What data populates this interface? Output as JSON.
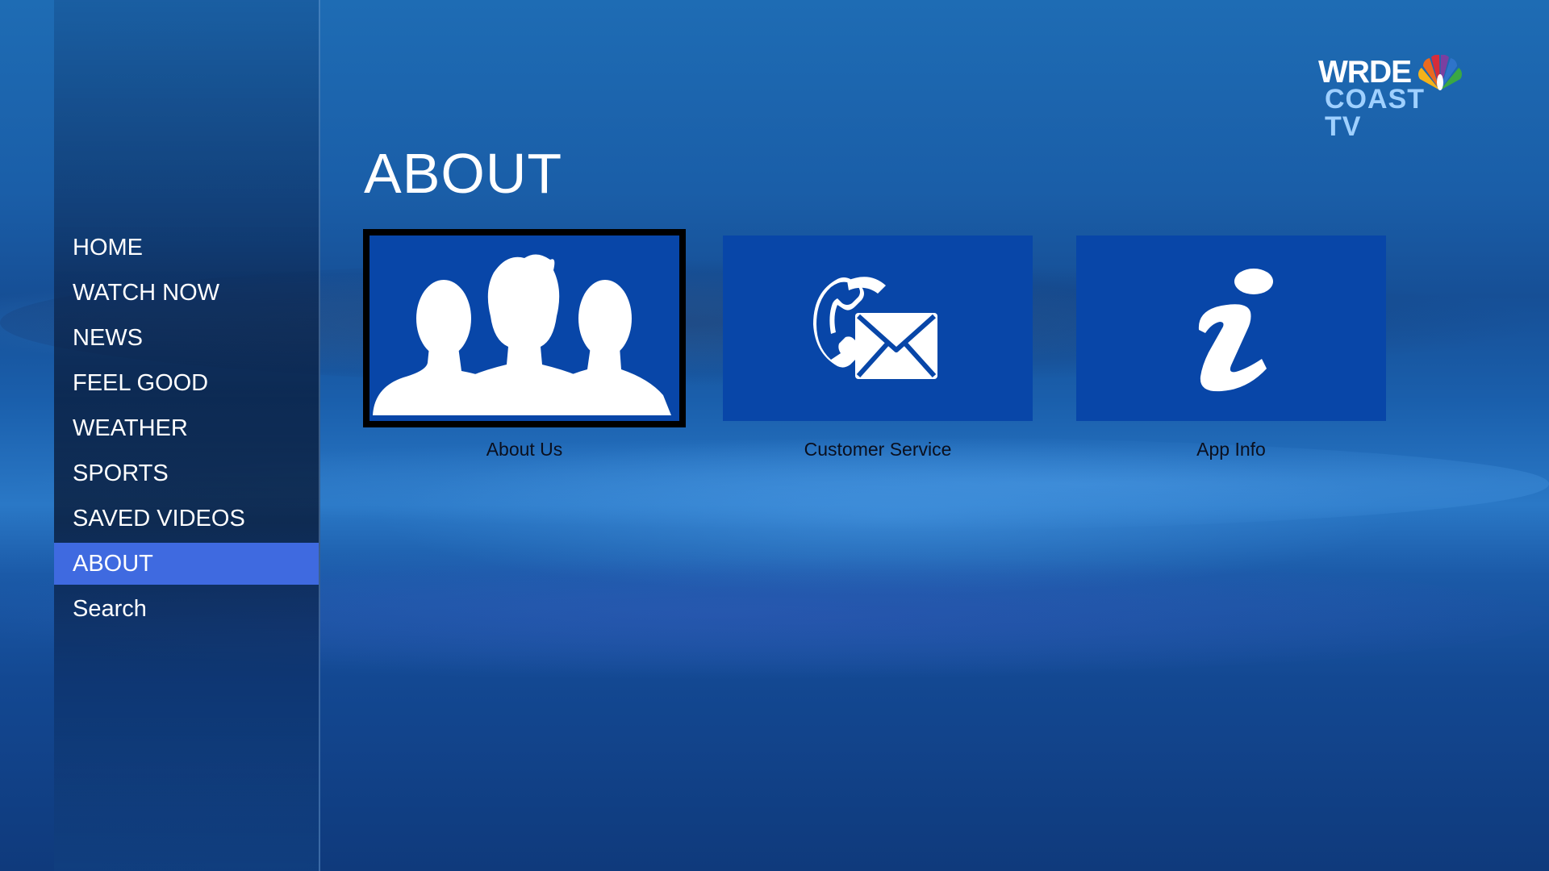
{
  "page": {
    "title": "ABOUT"
  },
  "logo": {
    "line1": "WRDE",
    "line2": "COAST TV",
    "mark_icon": "peacock-icon"
  },
  "sidebar": {
    "items": [
      {
        "label": "HOME",
        "active": false
      },
      {
        "label": "WATCH NOW",
        "active": false
      },
      {
        "label": "NEWS",
        "active": false
      },
      {
        "label": "FEEL GOOD",
        "active": false
      },
      {
        "label": "WEATHER",
        "active": false
      },
      {
        "label": "SPORTS",
        "active": false
      },
      {
        "label": "SAVED VIDEOS",
        "active": false
      },
      {
        "label": "ABOUT",
        "active": true
      },
      {
        "label": "Search",
        "active": false
      }
    ]
  },
  "tiles": [
    {
      "label": "About Us",
      "icon": "people-group-icon",
      "selected": true
    },
    {
      "label": "Customer Service",
      "icon": "phone-envelope-icon",
      "selected": false
    },
    {
      "label": "App Info",
      "icon": "info-icon",
      "selected": false
    }
  ],
  "colors": {
    "tile_bg": "#0846a8",
    "active_nav": "#3f6ae0",
    "selection_border": "#000000"
  }
}
